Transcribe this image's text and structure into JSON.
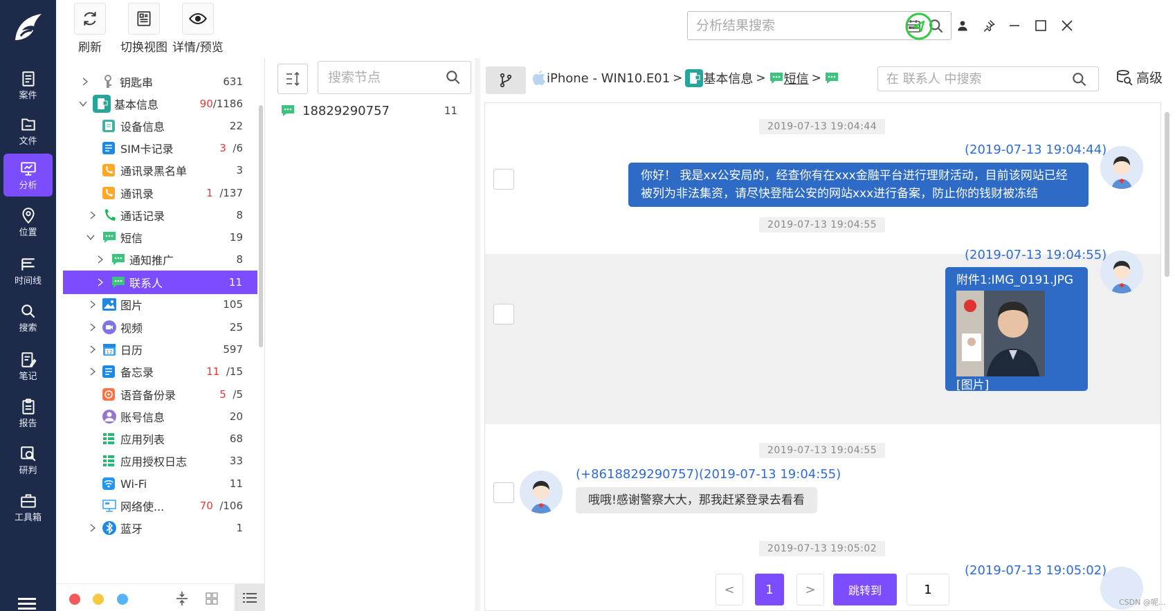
{
  "nav": {
    "items": [
      {
        "label": "案件",
        "icon": "case-icon"
      },
      {
        "label": "文件",
        "icon": "folder-icon"
      },
      {
        "label": "分析",
        "icon": "analysis-icon"
      },
      {
        "label": "位置",
        "icon": "location-icon"
      },
      {
        "label": "时间线",
        "icon": "timeline-icon"
      },
      {
        "label": "搜索",
        "icon": "search-icon"
      },
      {
        "label": "笔记",
        "icon": "note-icon"
      },
      {
        "label": "报告",
        "icon": "report-icon"
      },
      {
        "label": "研判",
        "icon": "judge-icon"
      },
      {
        "label": "工具箱",
        "icon": "toolbox-icon"
      }
    ]
  },
  "toolbar": {
    "refresh": "刷新",
    "switch_view": "切换视图",
    "detail_preview": "详情/预览",
    "search_placeholder": "分析结果搜索"
  },
  "tree": {
    "items": [
      {
        "name": "钥匙串",
        "count": "631",
        "red": ""
      },
      {
        "name": "基本信息",
        "count": "/1186",
        "red": "90"
      },
      {
        "name": "设备信息",
        "count": "22",
        "red": ""
      },
      {
        "name": "SIM卡记录",
        "count": "/6",
        "red": "3"
      },
      {
        "name": "通讯录黑名单",
        "count": "3",
        "red": ""
      },
      {
        "name": "通讯录",
        "count": "/137",
        "red": "1"
      },
      {
        "name": "通话记录",
        "count": "8",
        "red": ""
      },
      {
        "name": "短信",
        "count": "19",
        "red": ""
      },
      {
        "name": "通知推广",
        "count": "8",
        "red": ""
      },
      {
        "name": "联系人",
        "count": "11",
        "red": ""
      },
      {
        "name": "图片",
        "count": "105",
        "red": ""
      },
      {
        "name": "视频",
        "count": "25",
        "red": ""
      },
      {
        "name": "日历",
        "count": "597",
        "red": ""
      },
      {
        "name": "备忘录",
        "count": "/15",
        "red": "11"
      },
      {
        "name": "语音备份录",
        "count": "/5",
        "red": "5"
      },
      {
        "name": "账号信息",
        "count": "20",
        "red": ""
      },
      {
        "name": "应用列表",
        "count": "68",
        "red": ""
      },
      {
        "name": "应用授权日志",
        "count": "33",
        "red": ""
      },
      {
        "name": "Wi-Fi",
        "count": "11",
        "red": ""
      },
      {
        "name": "网络使...",
        "count": "/106",
        "red": "70"
      },
      {
        "name": "蓝牙",
        "count": "1",
        "red": ""
      }
    ]
  },
  "nodes": {
    "search_placeholder": "搜索节点",
    "item_number": "18829290757",
    "item_count": "11"
  },
  "breadcrumb": {
    "device": "iPhone - WIN10.E01",
    "level1": "基本信息",
    "level2": "短信",
    "sep": ">"
  },
  "msg_search_placeholder": "在 联系人 中搜索",
  "advanced": "高级",
  "messages": {
    "ts1": "2019-07-13 19:04:44",
    "time1": "(2019-07-13 19:04:44)",
    "text1a": "你好！ 我是xx公安局的，经查你有在xxx金融平台进行理财活动，目前该网站已经",
    "text1b": "被列为非法集资，请尽快登陆公安的网站xxx进行备案，防止你的钱财被冻结",
    "ts2": "2019-07-13 19:04:55",
    "time2": "(2019-07-13 19:04:55)",
    "attach": "附件1:IMG_0191.JPG",
    "image_tag": "[图片]",
    "ts3": "2019-07-13 19:04:55",
    "time3": "(+8618829290757)(2019-07-13 19:04:55)",
    "text3": "哦哦!感谢警察大大，那我赶紧登录去看看",
    "ts4": "2019-07-13 19:05:02",
    "time4": "(2019-07-13 19:05:02)"
  },
  "pager": {
    "prev": "<",
    "current": "1",
    "next": ">",
    "jump": "跳转到",
    "input_value": "1"
  },
  "watermark": "CSDN @呢...",
  "colors": {
    "nav_bg": "#1e2a4a",
    "accent": "#7c4dff",
    "bubble": "#2d6bc6"
  }
}
